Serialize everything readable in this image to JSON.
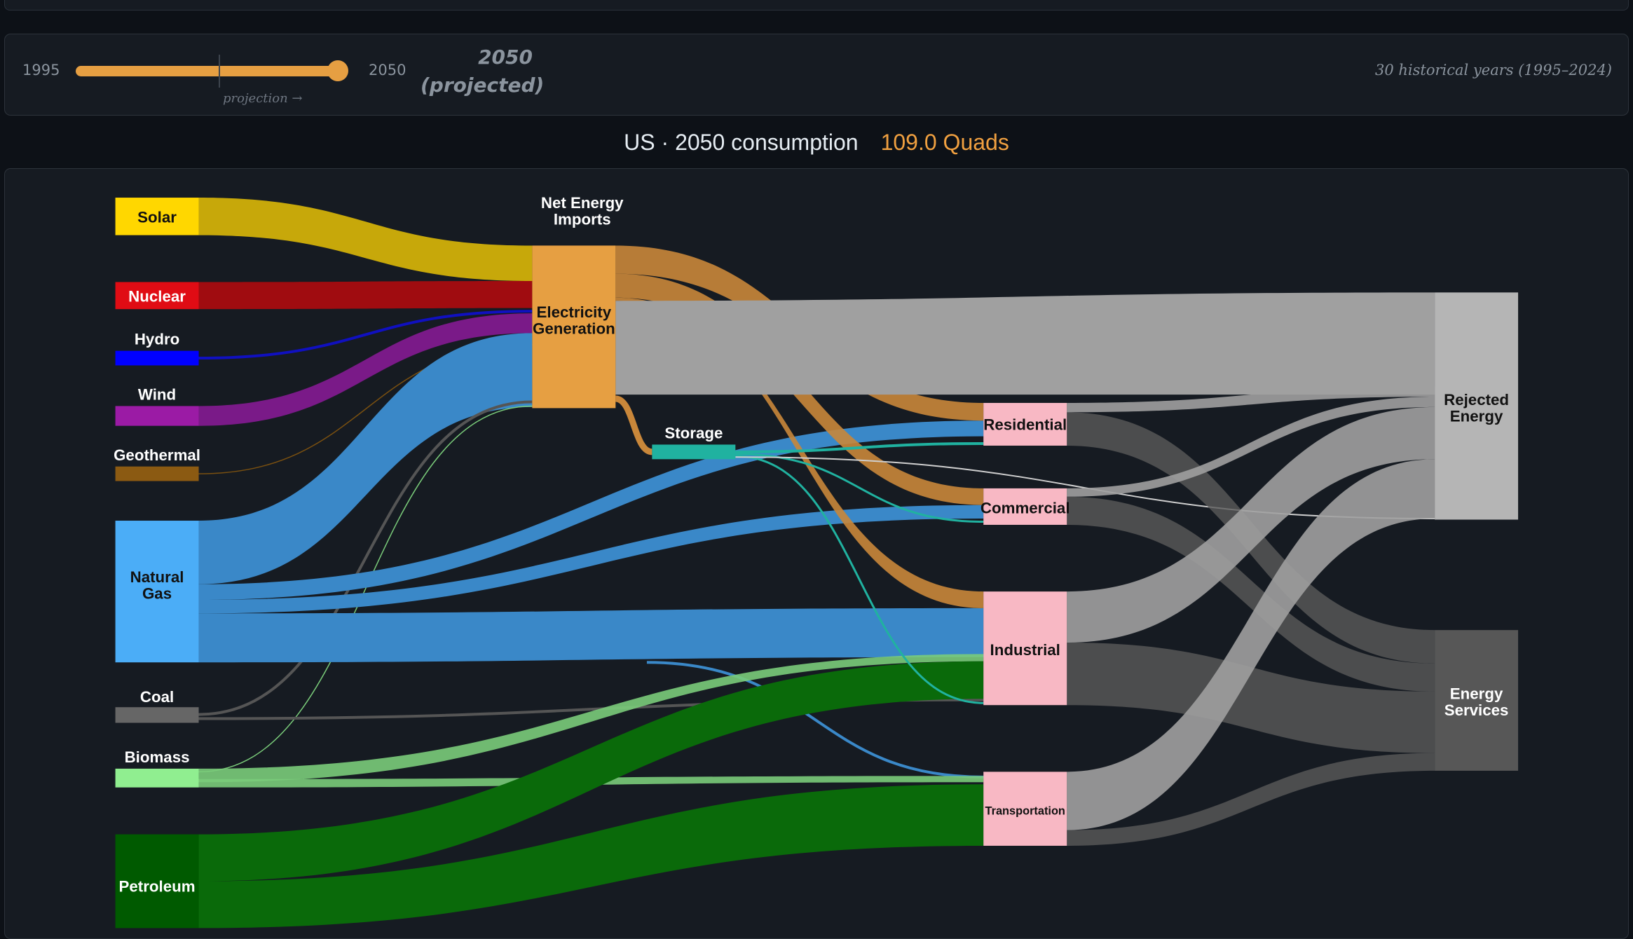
{
  "slider": {
    "min_label": "1995",
    "max_label": "2050",
    "projection_hint": "projection →",
    "year_label": "2050",
    "year_qualifier": "(projected)",
    "history_note": "30 historical years (1995–2024)",
    "value_year": 2050
  },
  "header": {
    "title": "US · 2050 consumption",
    "total": "109.0 Quads"
  },
  "colors": {
    "accent": "#e69f42",
    "background": "#0d1117",
    "panel": "#161b22"
  },
  "chart_data": {
    "type": "sankey",
    "nodes": [
      {
        "id": "solar",
        "label": "Solar",
        "color": "#ffd700"
      },
      {
        "id": "nuclear",
        "label": "Nuclear",
        "color": "#e00c14"
      },
      {
        "id": "hydro",
        "label": "Hydro",
        "color": "#0000ff"
      },
      {
        "id": "wind",
        "label": "Wind",
        "color": "#9b1ba5"
      },
      {
        "id": "geothermal",
        "label": "Geothermal",
        "color": "#8b5a12"
      },
      {
        "id": "gas",
        "label": "Natural Gas",
        "color": "#4badf7"
      },
      {
        "id": "coal",
        "label": "Coal",
        "color": "#666666"
      },
      {
        "id": "biomass",
        "label": "Biomass",
        "color": "#90ee90"
      },
      {
        "id": "petroleum",
        "label": "Petroleum",
        "color": "#005a00"
      },
      {
        "id": "imports",
        "label": "Net Energy Imports",
        "color": "#e69f42"
      },
      {
        "id": "elec",
        "label": "Electricity Generation",
        "color": "#e69f42"
      },
      {
        "id": "storage",
        "label": "Storage",
        "color": "#20b2a0"
      },
      {
        "id": "residential",
        "label": "Residential",
        "color": "#f8b8c4"
      },
      {
        "id": "commercial",
        "label": "Commercial",
        "color": "#f8b8c4"
      },
      {
        "id": "industrial",
        "label": "Industrial",
        "color": "#f8b8c4"
      },
      {
        "id": "transportation",
        "label": "Transportation",
        "color": "#f8b8c4"
      },
      {
        "id": "rejected",
        "label": "Rejected Energy",
        "color": "#b5b5b5"
      },
      {
        "id": "services",
        "label": "Energy Services",
        "color": "#575757"
      }
    ]
  }
}
